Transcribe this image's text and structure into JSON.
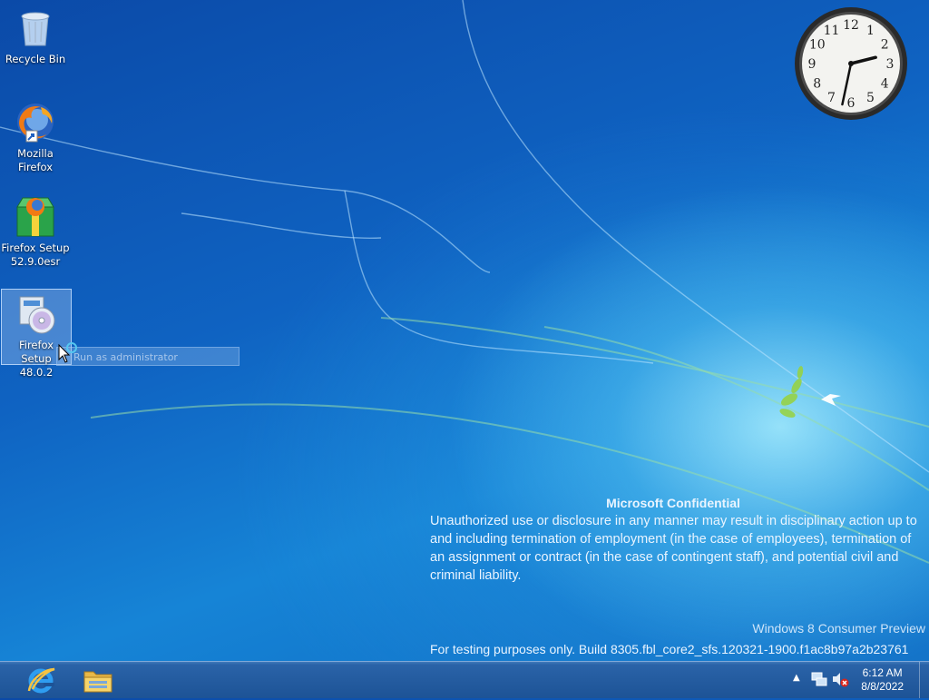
{
  "desktop": {
    "icons": [
      {
        "label": "Recycle Bin",
        "icon": "recycle-bin-icon"
      },
      {
        "label": "Mozilla Firefox",
        "icon": "firefox-icon"
      },
      {
        "label": "Firefox Setup 52.9.0esr",
        "icon": "firefox-installer-icon"
      },
      {
        "label": "Firefox Setup 48.0.2",
        "icon": "setup-disc-icon"
      }
    ],
    "context_hint": "Run as administrator"
  },
  "clock_gadget": {
    "time_shown": "2:32",
    "numerals": [
      "12",
      "1",
      "2",
      "3",
      "4",
      "5",
      "6",
      "7",
      "8",
      "9",
      "10",
      "11"
    ]
  },
  "watermark": {
    "title": "Microsoft Confidential",
    "body": "Unauthorized use or disclosure in any manner may result in disciplinary action up to and including termination of employment (in the case of employees), termination of an assignment or contract (in the case of contingent staff), and potential civil and criminal liability.",
    "edition": "Windows 8 Consumer Preview",
    "build": "For testing purposes only. Build 8305.fbl_core2_sfs.120321-1900.f1ac8b97a2b23761"
  },
  "taskbar": {
    "pinned": [
      {
        "name": "Internet Explorer",
        "icon": "internet-explorer-icon"
      },
      {
        "name": "File Explorer",
        "icon": "file-explorer-icon"
      }
    ],
    "tray": {
      "time": "6:12 AM",
      "date": "8/8/2022",
      "icons": [
        "show-hidden-icons-chevron-icon",
        "network-icon",
        "volume-muted-icon"
      ]
    }
  },
  "colors": {
    "desktop_blue": "#0f63c2",
    "taskbar": "#1d5396"
  }
}
